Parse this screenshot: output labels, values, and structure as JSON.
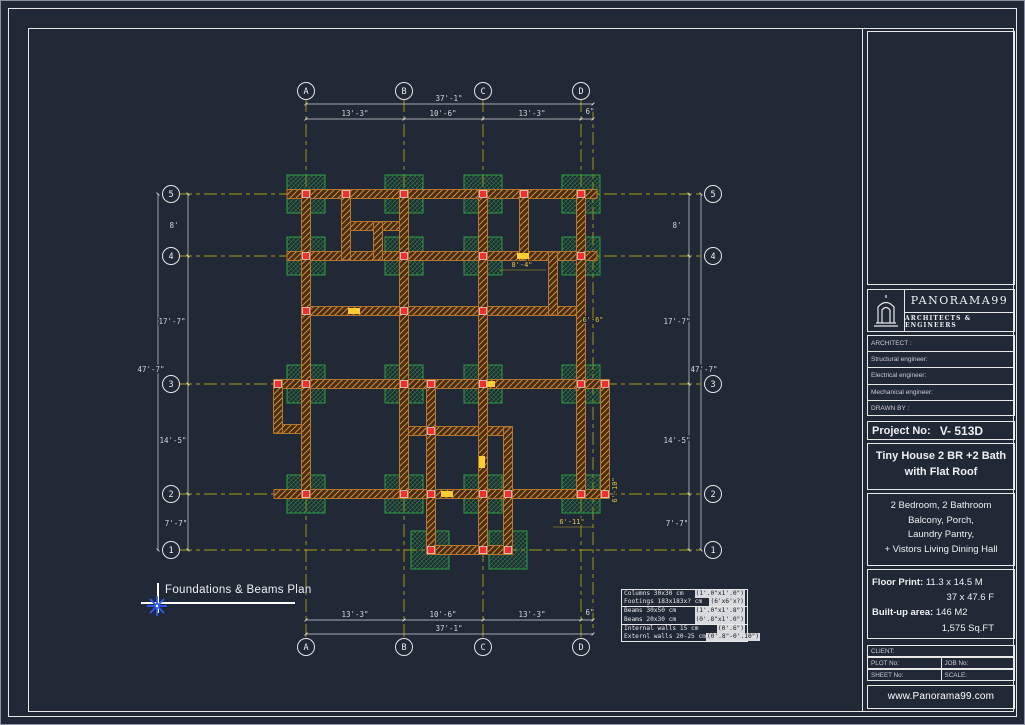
{
  "sheet": {
    "plan_title": "Foundations & Beams Plan"
  },
  "grid": {
    "cols": [
      "A",
      "B",
      "C",
      "D"
    ],
    "rows": [
      "5",
      "4",
      "3",
      "2",
      "1"
    ]
  },
  "dims": {
    "top_total": "37'-1\"",
    "top_segments": [
      "13'-3\"",
      "10'-6\"",
      "13'-3\"",
      "6\""
    ],
    "bottom_total": "37'-1\"",
    "bottom_segments": [
      "13'-3\"",
      "10'-6\"",
      "13'-3\"",
      "6\""
    ],
    "left_total": "47'-7\"",
    "left_segments": [
      "8'",
      "17'-7\"",
      "14'-5\"",
      "7'-7\""
    ],
    "right_total": "47'-7\"",
    "right_segments": [
      "8'",
      "17'-7\"",
      "14'-5\"",
      "7'-7\""
    ],
    "inner": [
      "8'-4\"",
      "6'-6\"",
      "6'-10\"",
      "6'-11\""
    ]
  },
  "notes": {
    "rows": [
      {
        "label": "Columns 30x30 cm",
        "value": "(1'.0\"x1'.0\")"
      },
      {
        "label": "Footings 183x183x? cm",
        "value": "(6'x6'x?)"
      },
      {
        "label": "Beams  30x50 cm",
        "value": "(1'.0\"x1'.8\")"
      },
      {
        "label": "Beams  20x30 cm",
        "value": "(0'.8\"x1'.0\")"
      },
      {
        "label": "Internal walls 15 cm",
        "value": "(0'.6\")"
      },
      {
        "label": "Externl walls 20-25 cm",
        "value": "(0'.8\"-0'.10\")"
      }
    ]
  },
  "title_block": {
    "company": "PANORAMA99",
    "tagline": "ARCHITECTS & ENGINEERS",
    "fields": [
      "ARCHITECT :",
      "Structural engineer:",
      "Electrical engineer:",
      "Mechanical engineer:",
      "DRAWN BY :"
    ],
    "project_no_label": "Project No:",
    "project_no_value": "V- 513D",
    "project_title_line1": "Tiny House 2 BR +2 Bath",
    "project_title_line2": "with Flat Roof",
    "description_lines": [
      "2 Bedroom, 2 Bathroom",
      "Balcony, Porch,",
      "Laundry Pantry,",
      "+ Vistors Living Dining Hall"
    ],
    "floor_print_label": "Floor Print:",
    "floor_print_metric": "11.3 x 14.5 M",
    "floor_print_imperial": "37 x 47.6 F",
    "built_up_label": "Built-up area:",
    "built_up_metric": "146 M2",
    "built_up_imperial": "1,575 Sq.FT",
    "client_label": "CLIENT:",
    "plot_label": "PLOT No:",
    "job_label": "JOB No:",
    "sheet_label": "SHEET No:",
    "scale_label": "SCALE:",
    "website": "www.Panorama99.com"
  },
  "colors": {
    "canvas": "#212836",
    "frame": "#e8e8e8",
    "yellow": "#b3a612",
    "dim": "#d4d4d4",
    "green": "#2f9e44",
    "beamline": "#b5762f",
    "beamfill": "#4a2d0e",
    "beamhatch": "#cf8f3e",
    "red": "#f03030",
    "star": "#2d5bff",
    "text": "#eef0f2"
  }
}
